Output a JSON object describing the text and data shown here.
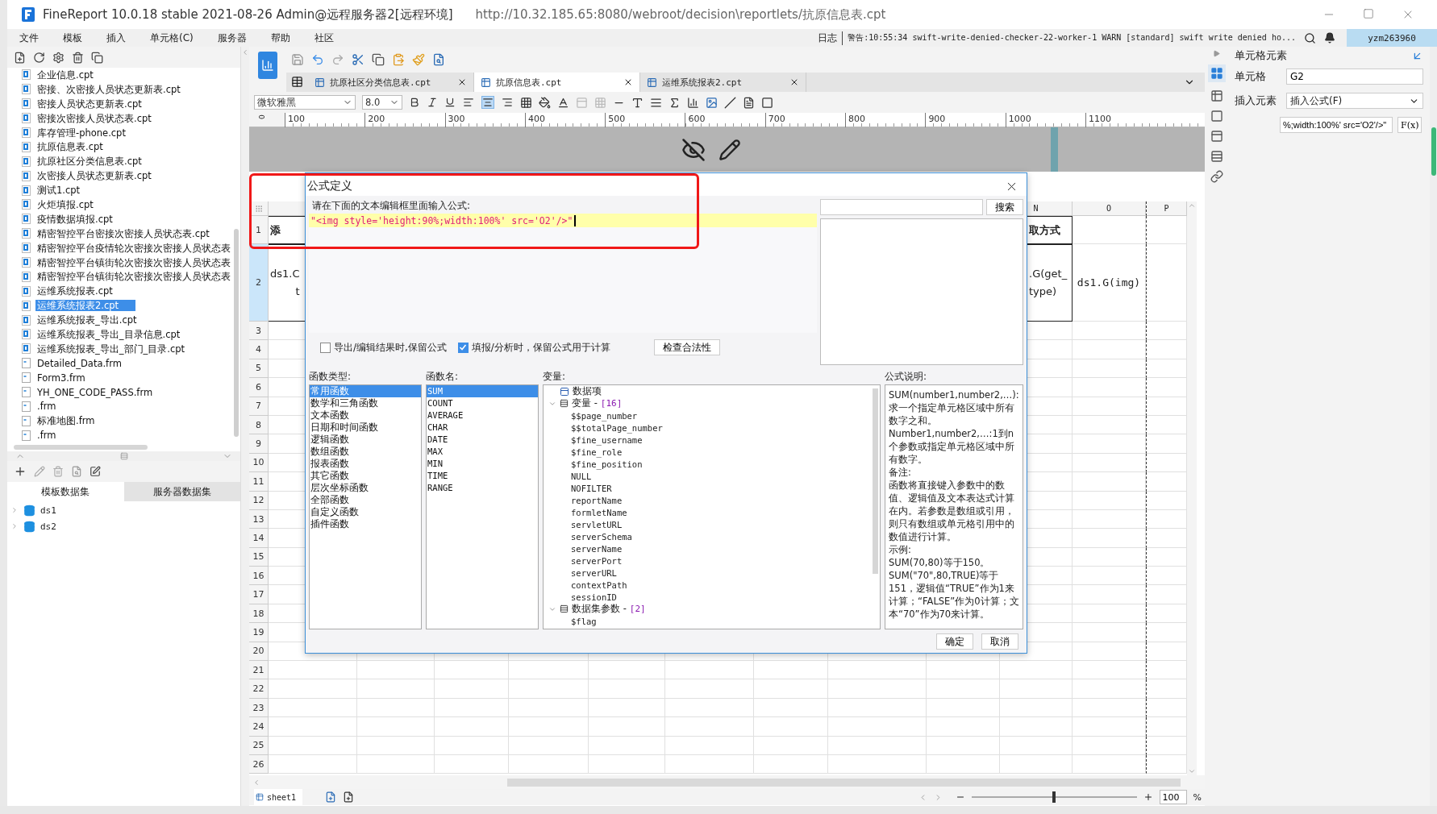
{
  "window": {
    "title": "FineReport 10.0.18 stable 2021-08-26 Admin@远程服务器2[远程环境]",
    "url": "http://10.32.185.65:8080/webroot/decision\\reportlets/抗原信息表.cpt"
  },
  "menu": [
    "文件",
    "模板",
    "插入",
    "单元格(C)",
    "服务器",
    "帮助",
    "社区"
  ],
  "log_bar": {
    "label": "日志",
    "message": "警告:10:55:34 swift-write-denied-checker-22-worker-1 WARN [standard] swift write denied ho...",
    "user": "yzm263960"
  },
  "file_tree": {
    "items": [
      {
        "name": "企业信息.cpt",
        "kind": "cpt",
        "selected": false
      },
      {
        "name": "密接、次密接人员状态更新表.cpt",
        "kind": "cpt",
        "selected": false
      },
      {
        "name": "密接人员状态更新表.cpt",
        "kind": "cpt",
        "selected": false
      },
      {
        "name": "密接次密接人员状态表.cpt",
        "kind": "cpt",
        "selected": false
      },
      {
        "name": "库存管理-phone.cpt",
        "kind": "cpt",
        "selected": false
      },
      {
        "name": "抗原信息表.cpt",
        "kind": "cpt",
        "selected": false
      },
      {
        "name": "抗原社区分类信息表.cpt",
        "kind": "cpt",
        "selected": false
      },
      {
        "name": "次密接人员状态更新表.cpt",
        "kind": "cpt",
        "selected": false
      },
      {
        "name": "测试1.cpt",
        "kind": "cpt",
        "selected": false
      },
      {
        "name": "火炬填报.cpt",
        "kind": "cpt",
        "selected": false
      },
      {
        "name": "疫情数据填报.cpt",
        "kind": "cpt",
        "selected": false
      },
      {
        "name": "精密智控平台密接次密接人员状态表.cpt",
        "kind": "cpt",
        "selected": false
      },
      {
        "name": "精密智控平台疫情轮次密接次密接人员状态表",
        "kind": "cpt",
        "selected": false
      },
      {
        "name": "精密智控平台镇街轮次密接次密接人员状态表",
        "kind": "cpt",
        "selected": false
      },
      {
        "name": "精密智控平台镇街轮次密接次密接人员状态表",
        "kind": "cpt",
        "selected": false
      },
      {
        "name": "运维系统报表.cpt",
        "kind": "cpt",
        "selected": false
      },
      {
        "name": "运维系统报表2.cpt",
        "kind": "cpt",
        "selected": true
      },
      {
        "name": "运维系统报表_导出.cpt",
        "kind": "cpt",
        "selected": false
      },
      {
        "name": "运维系统报表_导出_目录信息.cpt",
        "kind": "cpt",
        "selected": false
      },
      {
        "name": "运维系统报表_导出_部门_目录.cpt",
        "kind": "cpt",
        "selected": false
      },
      {
        "name": "Detailed_Data.frm",
        "kind": "frm",
        "selected": false
      },
      {
        "name": "Form3.frm",
        "kind": "frm",
        "selected": false
      },
      {
        "name": "YH_ONE_CODE_PASS.frm",
        "kind": "frm",
        "selected": false
      },
      {
        "name": ".frm",
        "kind": "frm",
        "selected": false
      },
      {
        "name": "标准地图.frm",
        "kind": "frm",
        "selected": false
      },
      {
        "name": ".frm",
        "kind": "frm",
        "selected": false
      }
    ]
  },
  "dataset_panel": {
    "tabs": [
      {
        "label": "模板数据集",
        "selected": true
      },
      {
        "label": "服务器数据集",
        "selected": false
      }
    ],
    "datasets": [
      {
        "name": "ds1",
        "expanded": false
      },
      {
        "name": "ds2",
        "expanded": false
      }
    ]
  },
  "editor_tabs": [
    {
      "label": "抗原社区分类信息表.cpt",
      "selected": false
    },
    {
      "label": "抗原信息表.cpt",
      "selected": true
    },
    {
      "label": "运维系统报表2.cpt",
      "selected": false
    }
  ],
  "format_bar": {
    "font": "微软雅黑",
    "size": "8.0",
    "align_buttons": [
      {
        "selected": false
      },
      {
        "selected": true
      },
      {
        "selected": false
      }
    ]
  },
  "ruler": {
    "vertical_mark": "0",
    "marks": [
      "100",
      "200",
      "300",
      "400",
      "500",
      "600",
      "700",
      "800",
      "900",
      "1000",
      "1100"
    ]
  },
  "grid": {
    "column_headers": [
      "N",
      "O",
      "P"
    ],
    "rows": [
      {
        "number": "1",
        "selected": false,
        "cells": {
          "first_column": [
            "添"
          ],
          "N": [
            "取方式"
          ]
        }
      },
      {
        "number": "2",
        "selected": true,
        "cells": {
          "first_column": [
            "ds1.C",
            "t"
          ],
          "N": [
            ".G(get_",
            "type)"
          ],
          "O": [
            "ds1.G(img)"
          ]
        }
      },
      {
        "number": "3",
        "selected": false
      },
      {
        "number": "4",
        "selected": false
      },
      {
        "number": "5",
        "selected": false
      },
      {
        "number": "6",
        "selected": false
      },
      {
        "number": "7",
        "selected": false
      },
      {
        "number": "8",
        "selected": false
      },
      {
        "number": "9",
        "selected": false
      },
      {
        "number": "10",
        "selected": false
      },
      {
        "number": "11",
        "selected": false
      },
      {
        "number": "12",
        "selected": false
      },
      {
        "number": "13",
        "selected": false
      },
      {
        "number": "14",
        "selected": false
      },
      {
        "number": "15",
        "selected": false
      },
      {
        "number": "16",
        "selected": false
      },
      {
        "number": "17",
        "selected": false
      },
      {
        "number": "18",
        "selected": false
      },
      {
        "number": "19",
        "selected": false
      },
      {
        "number": "20",
        "selected": false
      },
      {
        "number": "21",
        "selected": false
      },
      {
        "number": "22",
        "selected": false
      },
      {
        "number": "23",
        "selected": false
      },
      {
        "number": "24",
        "selected": false
      },
      {
        "number": "25",
        "selected": false
      },
      {
        "number": "26",
        "selected": false
      }
    ]
  },
  "sheet_bar": {
    "tabs": [
      {
        "label": "sheet1",
        "selected": true
      }
    ],
    "zoom": {
      "level": 0.5,
      "value": "100",
      "unit": "%"
    }
  },
  "cell_element_panel": {
    "title": "单元格元素",
    "cell_label": "单元格",
    "cell_value": "G2",
    "insert_label": "插入元素",
    "insert_value": "插入公式(F)",
    "formula_value": "%;width:100%' src='O2'/>\"",
    "formula_button": "F(x)"
  },
  "dialog": {
    "title": "公式定义",
    "prompt": "请在下面的文本编辑框里面输入公式:",
    "formula": "\"<img style='height:90%;width:100%' src='O2'/>\"",
    "search_button": "搜索",
    "options": [
      {
        "label": "导出/编辑结果时,保留公式",
        "checked": false
      },
      {
        "label": "填报/分析时，保留公式用于计算",
        "checked": true
      }
    ],
    "check_button": "检查合法性",
    "function_types": {
      "title": "函数类型:",
      "items": [
        {
          "label": "常用函数",
          "selected": true
        },
        {
          "label": "数学和三角函数",
          "selected": false
        },
        {
          "label": "文本函数",
          "selected": false
        },
        {
          "label": "日期和时间函数",
          "selected": false
        },
        {
          "label": "逻辑函数",
          "selected": false
        },
        {
          "label": "数组函数",
          "selected": false
        },
        {
          "label": "报表函数",
          "selected": false
        },
        {
          "label": "其它函数",
          "selected": false
        },
        {
          "label": "层次坐标函数",
          "selected": false
        },
        {
          "label": "全部函数",
          "selected": false
        },
        {
          "label": "自定义函数",
          "selected": false
        },
        {
          "label": "插件函数",
          "selected": false
        }
      ]
    },
    "function_names": {
      "title": "函数名:",
      "items": [
        {
          "label": "SUM",
          "selected": true
        },
        {
          "label": "COUNT",
          "selected": false
        },
        {
          "label": "AVERAGE",
          "selected": false
        },
        {
          "label": "CHAR",
          "selected": false
        },
        {
          "label": "DATE",
          "selected": false
        },
        {
          "label": "MAX",
          "selected": false
        },
        {
          "label": "MIN",
          "selected": false
        },
        {
          "label": "TIME",
          "selected": false
        },
        {
          "label": "RANGE",
          "selected": false
        }
      ]
    },
    "variables": {
      "title": "变量:",
      "items": [
        {
          "kind": "item",
          "label": "数据项"
        },
        {
          "kind": "group",
          "label": "变量 -",
          "count": "[16]",
          "expanded": true,
          "children": [
            "$$page_number",
            "$$totalPage_number",
            "$fine_username",
            "$fine_role",
            "$fine_position",
            "NULL",
            "NOFILTER",
            "reportName",
            "formletName",
            "servletURL",
            "serverSchema",
            "serverName",
            "serverPort",
            "serverURL",
            "contextPath",
            "sessionID"
          ]
        },
        {
          "kind": "group",
          "label": "数据集参数 -",
          "count": "[2]",
          "expanded": true,
          "children": [
            "$flag"
          ]
        }
      ]
    },
    "description": {
      "title": "公式说明:",
      "paragraphs": [
        "SUM(number1,number2,…):求一个指定单元格区域中所有数字之和。",
        "Number1,number2,…:1到n个参数或指定单元格区域中所有数字。",
        "备注:",
        "函数将直接键入参数中的数值、逻辑值及文本表达式计算在内。若参数是数组或引用，则只有数组或单元格引用中的数值进行计算。",
        "示例:",
        "SUM(70,80)等于150。",
        "SUM(\"70\",80,TRUE)等于151，逻辑值“TRUE”作为1来计算；“FALSE”作为0计算；文本“70”作为70来计算。"
      ]
    },
    "buttons": [
      "确定",
      "取消"
    ]
  }
}
